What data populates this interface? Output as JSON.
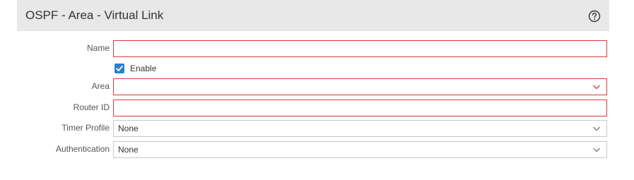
{
  "dialog": {
    "title": "OSPF - Area - Virtual Link",
    "help_icon": "question-circle-icon"
  },
  "form": {
    "name": {
      "label": "Name",
      "value": ""
    },
    "enable": {
      "label": "Enable",
      "checked": true
    },
    "area": {
      "label": "Area",
      "value": ""
    },
    "router_id": {
      "label": "Router ID",
      "value": ""
    },
    "timer_profile": {
      "label": "Timer Profile",
      "value": "None"
    },
    "authentication": {
      "label": "Authentication",
      "value": "None"
    }
  },
  "colors": {
    "header_bg": "#e8e8e8",
    "error_border": "#d9383a",
    "checkbox_accent": "#2b7fcf",
    "field_border": "#c8c8c8"
  }
}
